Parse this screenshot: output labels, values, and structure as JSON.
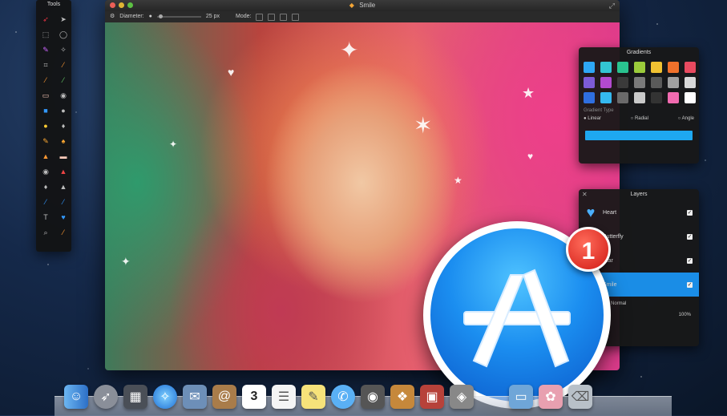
{
  "document_window": {
    "title": "Smile",
    "toolbar": {
      "diameter_label": "Diameter:",
      "diameter_value": "25 px",
      "mode_label": "Mode:"
    }
  },
  "tools_palette": {
    "title": "Tools",
    "tools": [
      "arrow-icon",
      "select-icon",
      "rect-select-icon",
      "ellipse-select-icon",
      "lasso-icon",
      "wand-icon",
      "crop-icon",
      "pen-icon",
      "brush-icon",
      "pencil-icon",
      "eraser-icon",
      "fill-icon",
      "rect-icon",
      "ellipse-icon",
      "smudge-icon",
      "blur-icon",
      "sponge-icon",
      "dodge-icon",
      "stamp-icon",
      "heal-icon",
      "eye-icon",
      "sharpen-icon",
      "drop-icon",
      "triangle-icon",
      "line-icon",
      "curve-icon",
      "text-icon",
      "heart-icon",
      "zoom-icon",
      "picker-icon"
    ]
  },
  "gradients_panel": {
    "title": "Gradients",
    "swatches": [
      "#2ea7f5",
      "#33c5d3",
      "#29c38f",
      "#9bcb3b",
      "#f1c232",
      "#f0712b",
      "#e84a5f",
      "#7c5bd6",
      "#b34ad0",
      "#3a3a3a",
      "#7a7a7a",
      "#5a5a5a",
      "#a0a0a0",
      "#d8d8d8",
      "#2f6fe0",
      "#35b9f0",
      "#6a6a6a",
      "#c9c9c9",
      "#333333",
      "#f16bb0",
      "#ffffff"
    ],
    "gradient_type_label": "Gradient Type",
    "types": [
      "Linear",
      "Radial",
      "Angle"
    ],
    "gradient_color": "#1ea8f0"
  },
  "layers_panel": {
    "title": "Layers",
    "layers": [
      {
        "name": "Heart",
        "visible": true,
        "selected": false
      },
      {
        "name": "Butterfly",
        "visible": true,
        "selected": false
      },
      {
        "name": "Star",
        "visible": true,
        "selected": false
      },
      {
        "name": "Smile",
        "visible": true,
        "selected": true
      }
    ],
    "blend_mode": "Normal",
    "opacity": "100%"
  },
  "app_store": {
    "badge_count": "1",
    "accent": "#1b8ef0"
  },
  "dock": {
    "items": [
      "finder-icon",
      "launchpad-icon",
      "mission-control-icon",
      "safari-icon",
      "mail-icon",
      "contacts-icon",
      "calendar-icon",
      "reminders-icon",
      "notes-icon",
      "messages-icon",
      "facetime-icon",
      "photo-booth-icon",
      "preview-icon",
      "pixelmator-icon",
      "app-store-icon",
      "folder-icon",
      "photos-icon",
      "trash-icon"
    ],
    "calendar_day": "3"
  }
}
